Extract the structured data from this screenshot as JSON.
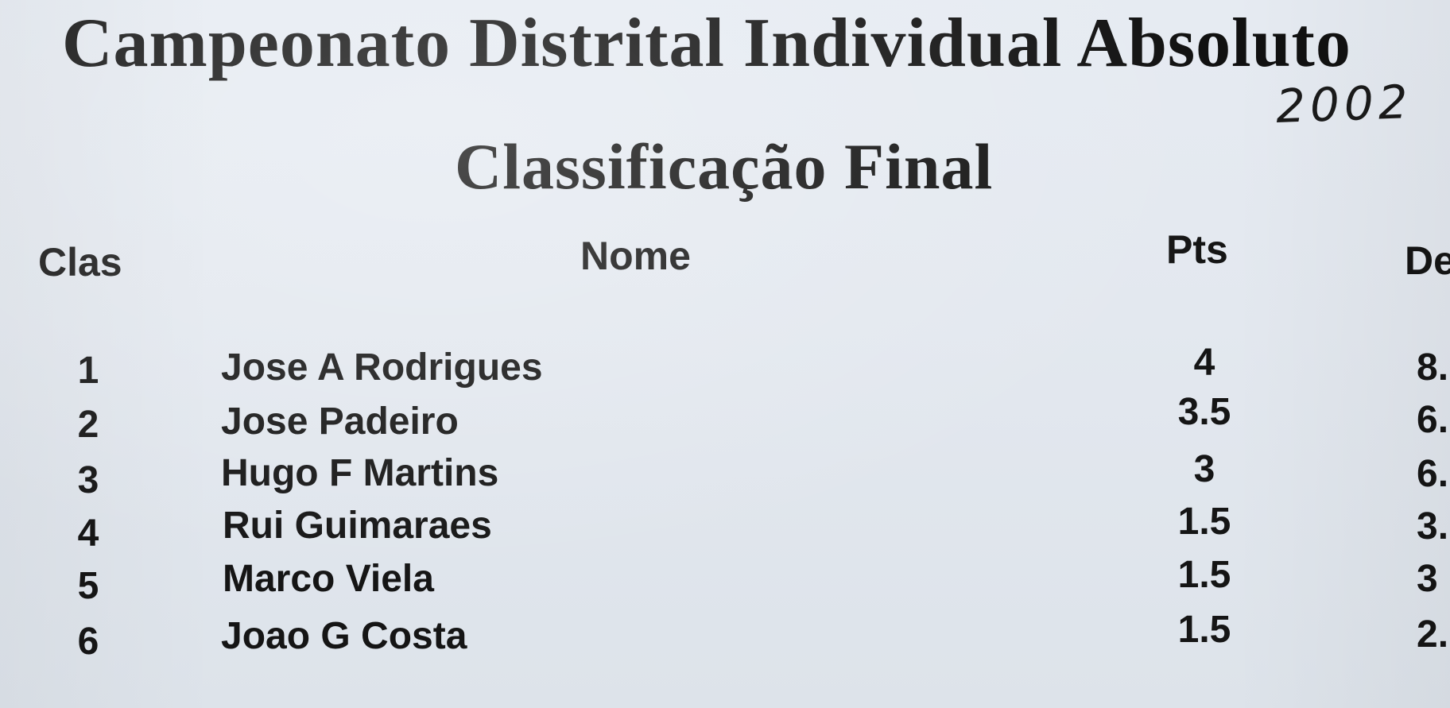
{
  "document": {
    "title": "Campeonato Distrital Individual Absoluto",
    "handwritten_year": "2002",
    "subtitle": "Classificação Final"
  },
  "table": {
    "headers": {
      "clas": "Clas",
      "nome": "Nome",
      "pts": "Pts",
      "de": "De"
    },
    "rows": [
      {
        "clas": "1",
        "nome": "Jose A Rodrigues",
        "pts": "4",
        "de": "8."
      },
      {
        "clas": "2",
        "nome": "Jose Padeiro",
        "pts": "3.5",
        "de": "6."
      },
      {
        "clas": "3",
        "nome": "Hugo F Martins",
        "pts": "3",
        "de": "6."
      },
      {
        "clas": "4",
        "nome": "Rui Guimaraes",
        "pts": "1.5",
        "de": "3."
      },
      {
        "clas": "5",
        "nome": "Marco Viela",
        "pts": "1.5",
        "de": "3"
      },
      {
        "clas": "6",
        "nome": "Joao G Costa",
        "pts": "1.5",
        "de": "2."
      }
    ]
  }
}
